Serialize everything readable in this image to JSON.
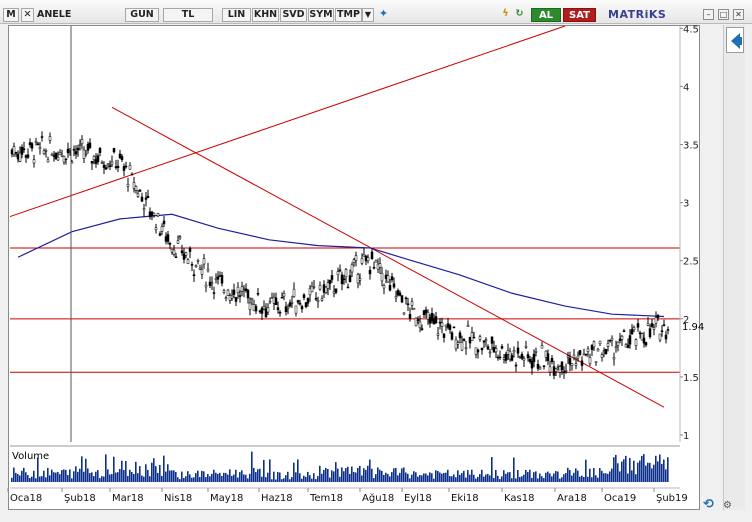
{
  "toolbar": {
    "logo": "M",
    "symbol": "ANELE",
    "buttons": [
      "GUN",
      "TL",
      "LIN",
      "KHN",
      "SVD",
      "SYM",
      "TMP"
    ],
    "buy_label": "AL",
    "sell_label": "SAT",
    "brand": "MATRiKS"
  },
  "panels": {
    "volume_label": "Volume"
  },
  "colors": {
    "price": "#000000",
    "moving_average": "#2020a0",
    "trendline": "#cc0000",
    "volume": "#0b2f8a",
    "buy": "#2d8a2d",
    "sell": "#b11d1d"
  },
  "chart_data": [
    {
      "type": "candlestick",
      "symbol": "ANELE",
      "x_ticks": [
        "Oca18",
        "Şub18",
        "Mar18",
        "Nis18",
        "May18",
        "Haz18",
        "Tem18",
        "Ağu18",
        "Eyl18",
        "Eki18",
        "Kas18",
        "Ara18",
        "Oca19",
        "Şub19"
      ],
      "y_ticks": [
        1,
        1.5,
        2,
        2.5,
        3,
        3.5,
        4,
        4.5
      ],
      "ylim": [
        0.94,
        4.52
      ],
      "last_price": 1.94,
      "price_series": [
        {
          "x": "Oca18",
          "y": 3.45
        },
        {
          "x": "Şub18",
          "y": 3.45
        },
        {
          "x": "Mar18",
          "y": 3.35
        },
        {
          "x": "Nis18",
          "y": 2.65
        },
        {
          "x": "May18",
          "y": 2.3
        },
        {
          "x": "Haz18",
          "y": 2.1
        },
        {
          "x": "Tem18",
          "y": 2.2
        },
        {
          "x": "Ağu18",
          "y": 2.5
        },
        {
          "x": "Eyl18",
          "y": 2.05
        },
        {
          "x": "Eki18",
          "y": 1.85
        },
        {
          "x": "Kas18",
          "y": 1.7
        },
        {
          "x": "Ara18",
          "y": 1.62
        },
        {
          "x": "Oca19",
          "y": 1.75
        },
        {
          "x": "Şub19",
          "y": 1.94
        }
      ],
      "moving_average": [
        {
          "x": "Oca18",
          "y": 2.53
        },
        {
          "x": "Şub18",
          "y": 2.75
        },
        {
          "x": "Mar18",
          "y": 2.86
        },
        {
          "x": "Nis18",
          "y": 2.9
        },
        {
          "x": "May18",
          "y": 2.78
        },
        {
          "x": "Haz18",
          "y": 2.68
        },
        {
          "x": "Tem18",
          "y": 2.63
        },
        {
          "x": "Ağu18",
          "y": 2.61
        },
        {
          "x": "Eyl18",
          "y": 2.5
        },
        {
          "x": "Eki18",
          "y": 2.38
        },
        {
          "x": "Kas18",
          "y": 2.22
        },
        {
          "x": "Ara18",
          "y": 2.11
        },
        {
          "x": "Oca19",
          "y": 2.04
        },
        {
          "x": "Şub19",
          "y": 2.02
        }
      ],
      "horizontal_lines": [
        2.61,
        2.0,
        1.54
      ],
      "trendlines": [
        {
          "from": {
            "x": "Oca18",
            "y": 2.88
          },
          "to": {
            "x": "Ara18",
            "y": 4.52
          }
        },
        {
          "from": {
            "x": "Mar18",
            "y": 3.82
          },
          "to": {
            "x": "Şub19",
            "y": 1.24
          }
        }
      ]
    },
    {
      "type": "bar",
      "title": "Volume",
      "y_ticks": [],
      "categories": [
        "Oca18",
        "Şub18",
        "Mar18",
        "Nis18",
        "May18",
        "Haz18",
        "Tem18",
        "Ağu18",
        "Eyl18",
        "Eki18",
        "Kas18",
        "Ara18",
        "Oca19",
        "Şub19"
      ],
      "values": [
        0.35,
        0.4,
        0.55,
        0.3,
        0.35,
        0.25,
        0.4,
        0.35,
        0.3,
        0.3,
        0.3,
        0.35,
        0.7,
        0.5
      ]
    }
  ]
}
